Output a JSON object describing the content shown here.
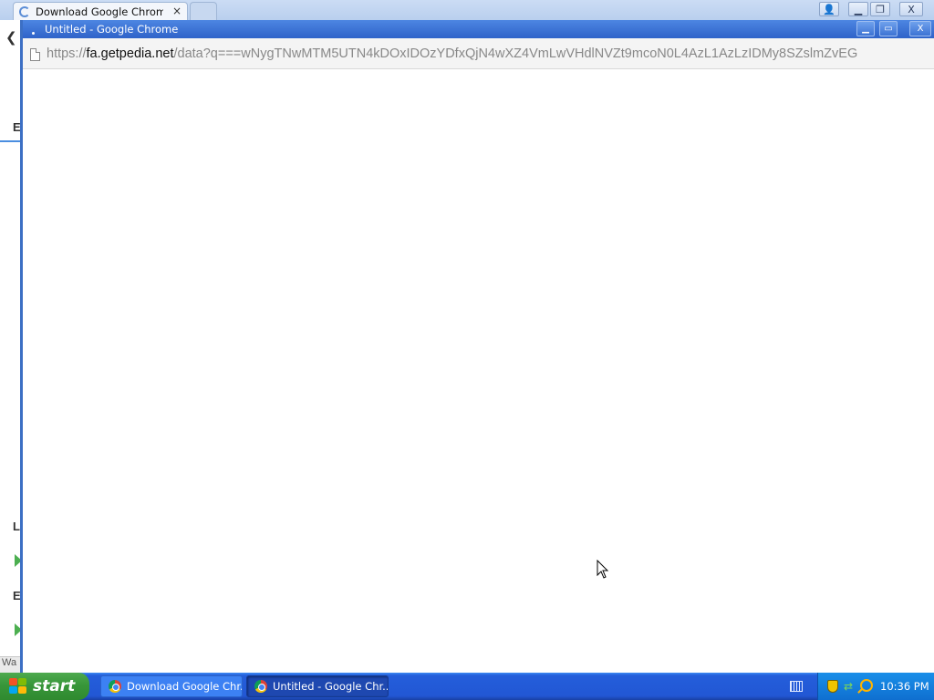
{
  "background_window": {
    "tabs": [
      {
        "label": "Download Google Chrome - T",
        "close": "×"
      },
      {
        "label": ""
      }
    ],
    "controls": {
      "user": "👤",
      "minimize": "▁",
      "maximize": "❐",
      "close": "X"
    },
    "back": "❮",
    "fragments": {
      "f1": "E",
      "f2": "L",
      "f3": "E",
      "status": "Wa"
    }
  },
  "popup": {
    "title": "Untitled - Google Chrome",
    "controls": {
      "minimize": "▁",
      "maximize": "▭",
      "close": "X"
    },
    "url": {
      "scheme": "https://",
      "host": "fa.getpedia.net",
      "path": "/data?q===wNygTNwMTM5UTN4kDOxIDOzYDfxQjN4wXZ4VmLwVHdlNVZt9mcoN0L4AzL1AzLzIDMy8SZslmZvEG"
    }
  },
  "taskbar": {
    "start_label": "start",
    "tasks": [
      {
        "label": "Download Google Chr..."
      },
      {
        "label": "Untitled - Google Chr..."
      }
    ],
    "clock": "10:36 PM"
  }
}
